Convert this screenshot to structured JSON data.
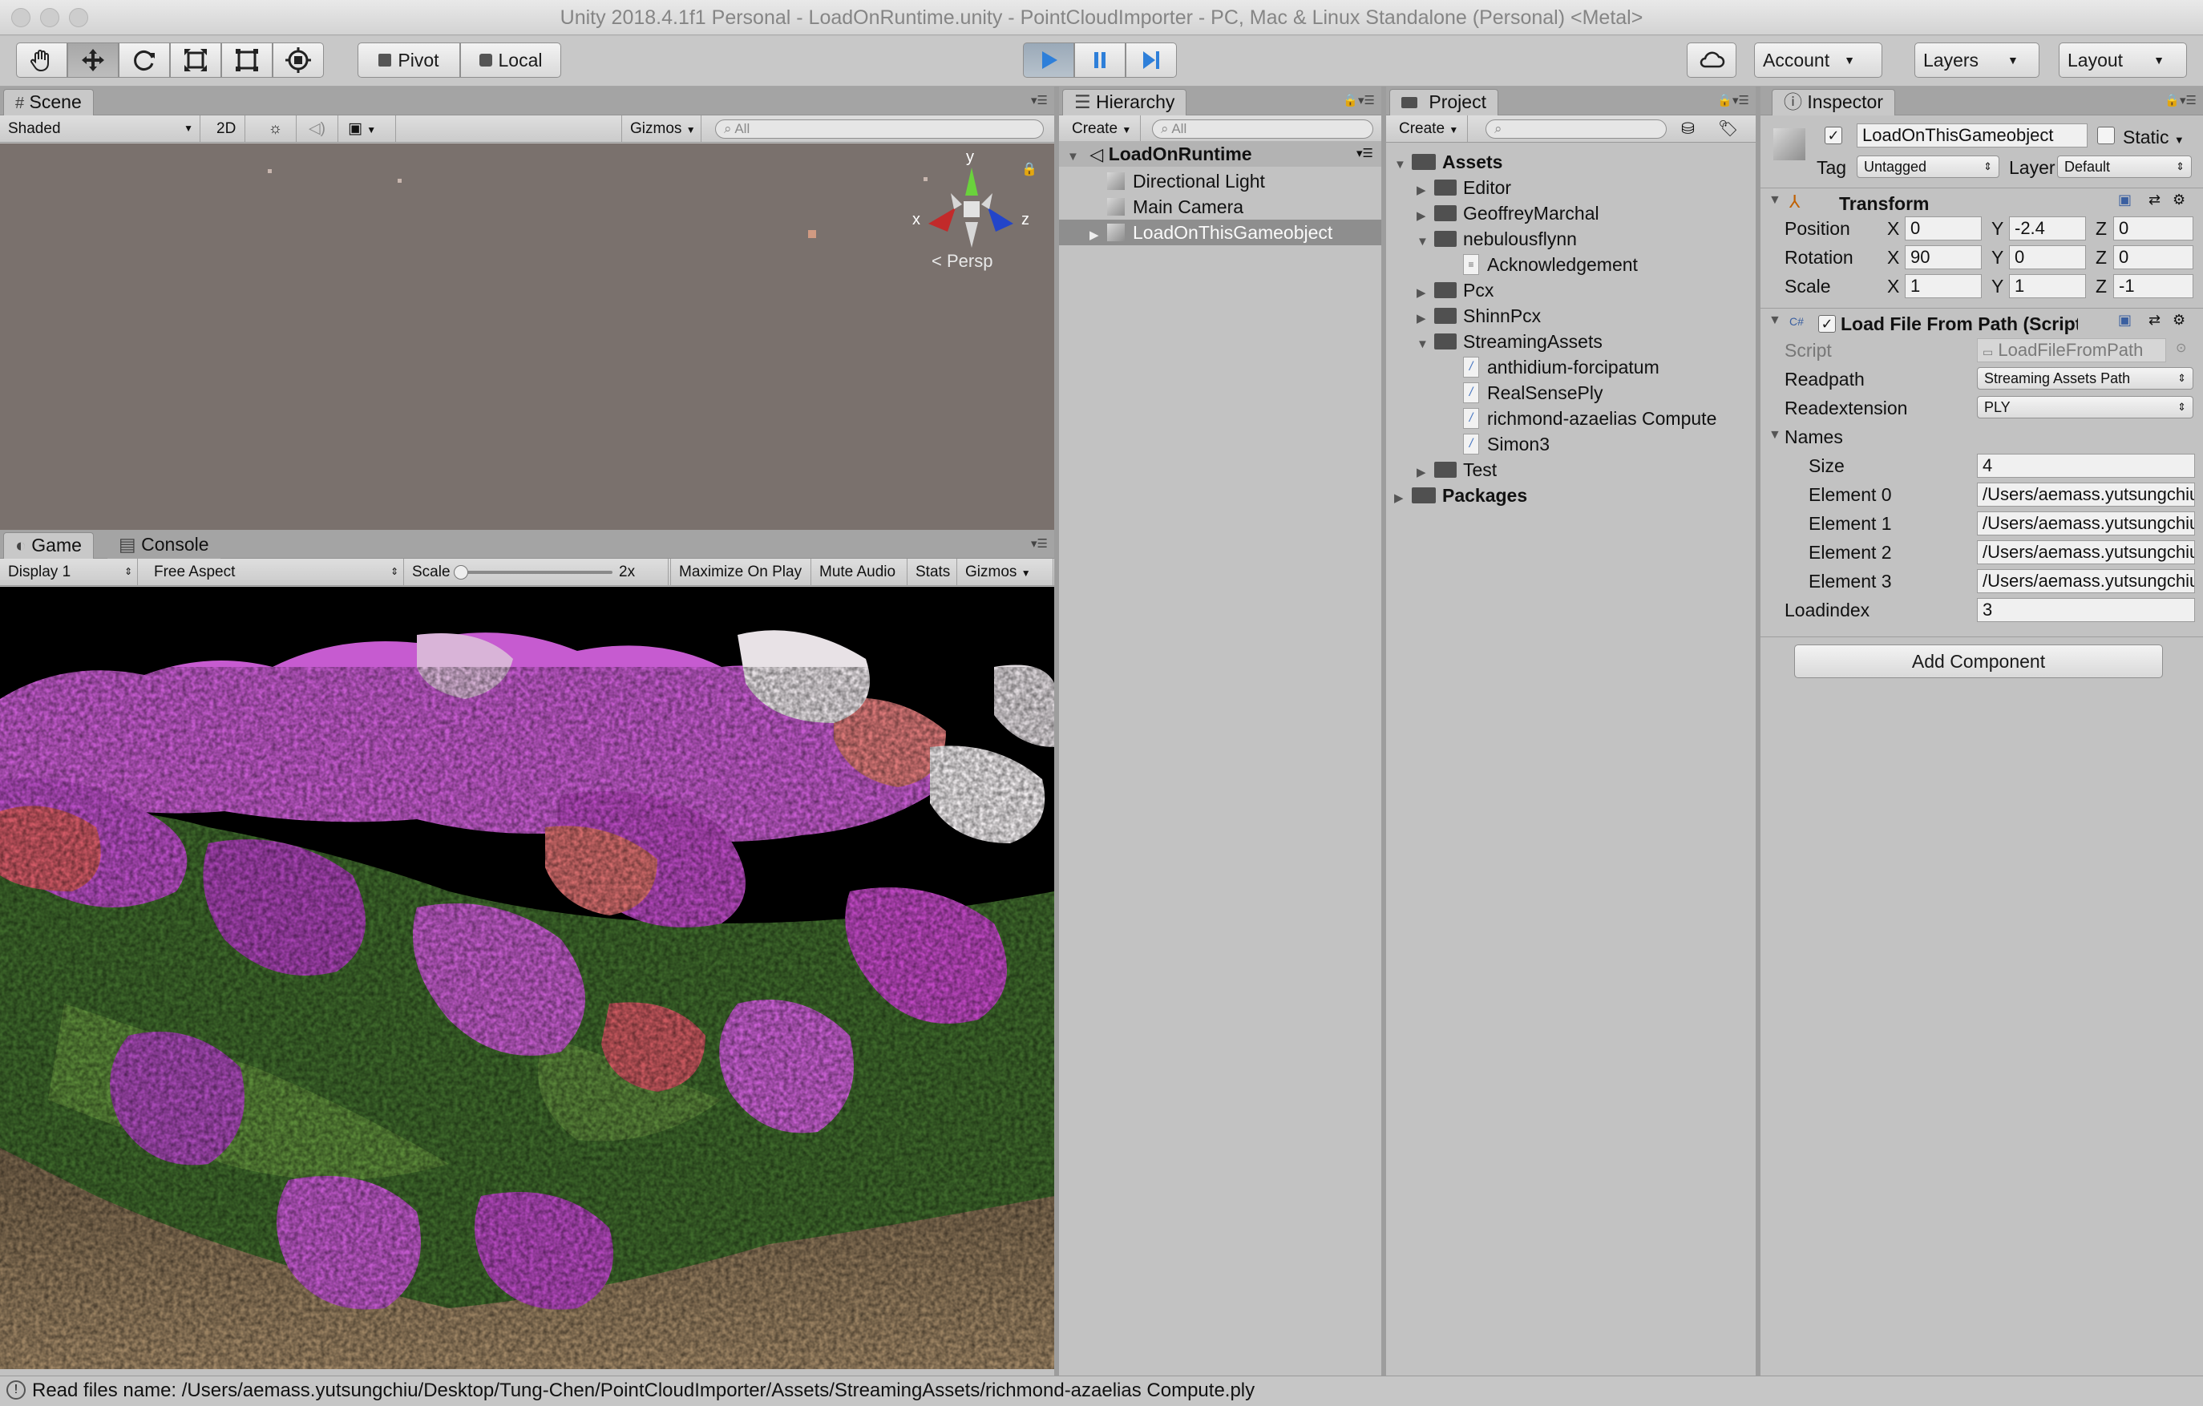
{
  "window": {
    "title": "Unity 2018.4.1f1 Personal - LoadOnRuntime.unity - PointCloudImporter - PC, Mac & Linux Standalone (Personal) <Metal>"
  },
  "toolbar": {
    "tools": [
      "hand-icon",
      "move-icon",
      "rotate-icon",
      "scale-icon",
      "rect-icon",
      "transform-icon"
    ],
    "pivot_label": "Pivot",
    "local_label": "Local",
    "play_controls": [
      "play-icon",
      "pause-icon",
      "step-icon"
    ],
    "account_label": "Account",
    "layers_label": "Layers",
    "layout_label": "Layout",
    "play_color": "#2e7fd9"
  },
  "scene": {
    "tab_label": "Scene",
    "shading_mode": "Shaded",
    "mode_2d": "2D",
    "gizmos_label": "Gizmos",
    "search_placeholder": "All",
    "gizmo": {
      "y": "y",
      "x": "x",
      "z": "z",
      "persp": "Persp"
    },
    "background_color": "#7a716d"
  },
  "game": {
    "tab_label": "Game",
    "console_tab_label": "Console",
    "display": "Display 1",
    "aspect": "Free Aspect",
    "scale_label": "Scale",
    "scale_value": "2x",
    "maximize_label": "Maximize On Play",
    "mute_label": "Mute Audio",
    "stats_label": "Stats",
    "gizmos_label": "Gizmos"
  },
  "hierarchy": {
    "tab_label": "Hierarchy",
    "create_label": "Create",
    "search_placeholder": "All",
    "scene_name": "LoadOnRuntime",
    "items": [
      "Directional Light",
      "Main Camera",
      "LoadOnThisGameobject"
    ],
    "selected_item": "LoadOnThisGameobject"
  },
  "project": {
    "tab_label": "Project",
    "create_label": "Create",
    "tree": {
      "assets_label": "Assets",
      "editor": "Editor",
      "geoffrey": "GeoffreyMarchal",
      "nebulous": "nebulousflynn",
      "acknowledgement": "Acknowledgement",
      "pcx": "Pcx",
      "shinn": "ShinnPcx",
      "streaming": "StreamingAssets",
      "files": [
        "anthidium-forcipatum",
        "RealSensePly",
        "richmond-azaelias Compute",
        "Simon3"
      ],
      "test": "Test",
      "packages": "Packages"
    }
  },
  "inspector": {
    "tab_label": "Inspector",
    "object_name": "LoadOnThisGameobject",
    "static_label": "Static",
    "tag_label": "Tag",
    "tag_value": "Untagged",
    "layer_label": "Layer",
    "layer_value": "Default",
    "transform": {
      "title": "Transform",
      "position_label": "Position",
      "rotation_label": "Rotation",
      "scale_label": "Scale",
      "axis_x": "X",
      "axis_y": "Y",
      "axis_z": "Z",
      "position": [
        "0",
        "-2.4",
        "0"
      ],
      "rotation": [
        "90",
        "0",
        "0"
      ],
      "scale": [
        "1",
        "1",
        "-1"
      ]
    },
    "script_component": {
      "title": "Load File From Path (Script)",
      "script_label": "Script",
      "script_value": "LoadFileFromPath",
      "readpath_label": "Readpath",
      "readpath_value": "Streaming Assets Path",
      "readextension_label": "Readextension",
      "readextension_value": "PLY",
      "names_label": "Names",
      "size_label": "Size",
      "size_value": "4",
      "elements": [
        {
          "label": "Element 0",
          "value": "/Users/aemass.yutsungchiu"
        },
        {
          "label": "Element 1",
          "value": "/Users/aemass.yutsungchiu"
        },
        {
          "label": "Element 2",
          "value": "/Users/aemass.yutsungchiu"
        },
        {
          "label": "Element 3",
          "value": "/Users/aemass.yutsungchiu"
        }
      ],
      "loadindex_label": "Loadindex",
      "loadindex_value": "3"
    },
    "add_component_label": "Add Component"
  },
  "status": {
    "message": "Read files name: /Users/aemass.yutsungchiu/Desktop/Tung-Chen/PointCloudImporter/Assets/StreamingAssets/richmond-azaelias Compute.ply"
  }
}
